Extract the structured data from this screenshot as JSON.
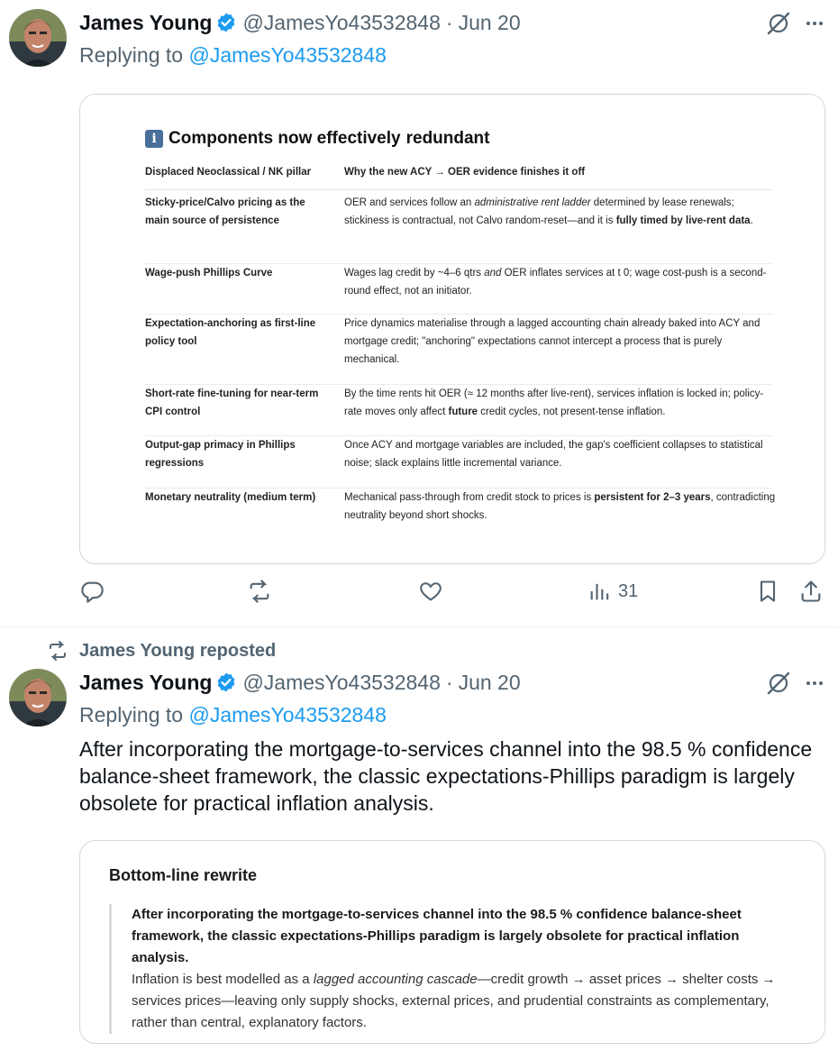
{
  "tweet1": {
    "author_name": "James Young",
    "handle": "@JamesYo43532848",
    "separator": "·",
    "date": "Jun 20",
    "replying_prefix": "Replying to",
    "replying_handle": "@JamesYo43532848",
    "table": {
      "title_prefix": "Components now effectively",
      "title_emph": "redundant",
      "col1_header": "Displaced Neoclassical / NK pillar",
      "col2_header": "Why the new ACY → OER evidence finishes it off",
      "rows": [
        {
          "pillar": "Sticky-price/Calvo pricing as the main source of persistence",
          "reason_a": "OER and services follow an ",
          "reason_i": "administrative rent ladder",
          "reason_b": " determined by lease renewals; stickiness is contractual, not Calvo random-reset—and it is ",
          "reason_bold": "fully timed by live-rent data",
          "reason_c": "."
        },
        {
          "pillar": "Wage-push Phillips Curve",
          "reason_a": "Wages lag credit by ~4–6 qtrs ",
          "reason_i": "and",
          "reason_b": " OER inflates services at t 0; wage cost-push is a second-round effect, not an initiator.",
          "reason_bold": "",
          "reason_c": ""
        },
        {
          "pillar": "Expectation-anchoring as first-line policy tool",
          "reason_a": "Price dynamics materialise through a lagged accounting chain already baked into ACY and mortgage credit; \"anchoring\" expectations cannot intercept a process that is purely mechanical.",
          "reason_i": "",
          "reason_b": "",
          "reason_bold": "",
          "reason_c": ""
        },
        {
          "pillar": "Short-rate fine-tuning for near-term CPI control",
          "reason_a": "By the time rents hit OER (≈ 12 months after live-rent), services inflation is locked in; policy-rate moves only affect ",
          "reason_i": "",
          "reason_b": "",
          "reason_bold": "future",
          "reason_c": " credit cycles, not present-tense inflation."
        },
        {
          "pillar": "Output-gap primacy in Phillips regressions",
          "reason_a": "Once ACY and mortgage variables are included, the gap's coefficient collapses to statistical noise; slack explains little incremental variance.",
          "reason_i": "",
          "reason_b": "",
          "reason_bold": "",
          "reason_c": ""
        },
        {
          "pillar": "Monetary neutrality (medium term)",
          "reason_a": "Mechanical pass-through from credit stock to prices is ",
          "reason_i": "",
          "reason_b": "",
          "reason_bold": "persistent for 2–3 years",
          "reason_c": ", contradicting neutrality beyond short shocks."
        }
      ]
    },
    "views_count": "31"
  },
  "tweet2": {
    "repost_label": "James Young reposted",
    "author_name": "James Young",
    "handle": "@JamesYo43532848",
    "separator": "·",
    "date": "Jun 20",
    "replying_prefix": "Replying to",
    "replying_handle": "@JamesYo43532848",
    "text": "After incorporating the mortgage-to-services channel into the 98.5 % confidence balance-sheet framework, the classic expectations-Phillips paradigm is largely obsolete for practical inflation analysis.",
    "card": {
      "title": "Bottom-line rewrite",
      "quote_bold": "After incorporating the mortgage-to-services channel into the 98.5 % confidence balance-sheet framework, the classic expectations-Phillips paradigm is largely obsolete for practical inflation analysis.",
      "quote_a": "Inflation is best modelled as a ",
      "quote_i": "lagged accounting cascade",
      "quote_b": "—credit growth → asset prices → shelter costs → services prices—leaving only supply shocks, external prices, and prudential constraints as complementary, rather than central, explanatory factors."
    }
  },
  "colors": {
    "text": "#0f1419",
    "muted": "#536471",
    "link": "#1d9bf0",
    "border": "#cfd9de"
  }
}
